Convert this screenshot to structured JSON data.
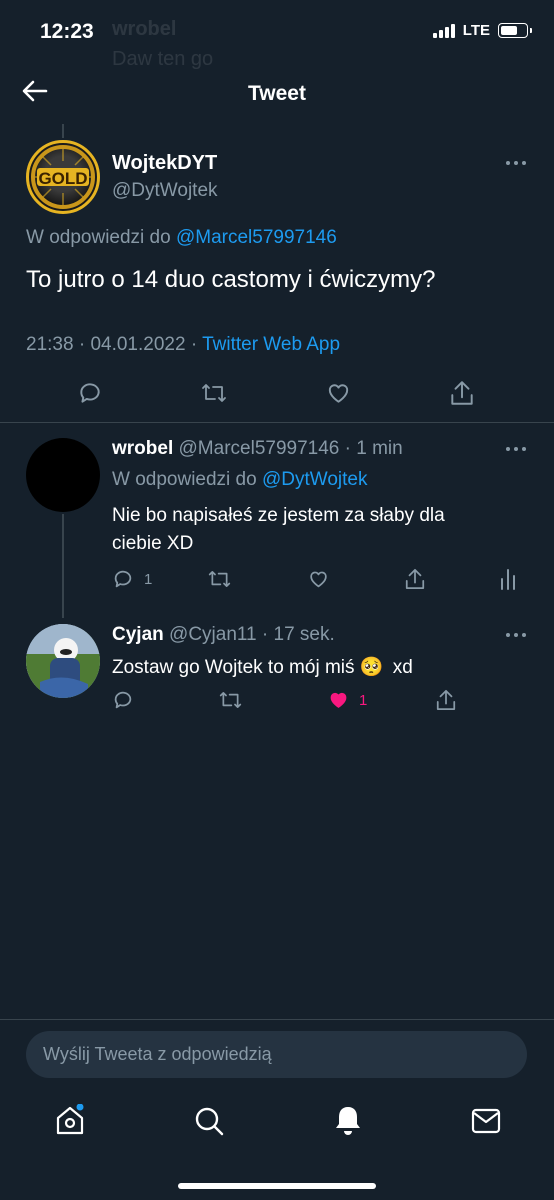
{
  "status_bar": {
    "time": "12:23",
    "network": "LTE"
  },
  "header": {
    "title": "Tweet"
  },
  "background_tweet": {
    "name": "wrobel",
    "text": "Daw ten go"
  },
  "main_tweet": {
    "display_name": "WojtekDYT",
    "handle": "@DytWojtek",
    "replying_prefix": "W odpowiedzi do",
    "replying_to": "@Marcel57997146",
    "text": "To jutro o 14 duo castomy i ćwiczymy?",
    "time": "21:38",
    "date": "04.01.2022",
    "source": "Twitter Web App",
    "avatar_text": "GOLD"
  },
  "replies": [
    {
      "display_name": "wrobel",
      "handle": "@Marcel57997146",
      "time_ago": "1 min",
      "replying_prefix": "W odpowiedzi do",
      "replying_to": "@DytWojtek",
      "text_line1": "Nie bo napisałeś ze jestem za słaby dla",
      "text_line2": "ciebie XD",
      "reply_count": "1"
    },
    {
      "display_name": "Cyjan",
      "handle": "@Cyjan11",
      "time_ago": "17 sek.",
      "text": "Zostaw go Wojtek to mój miś",
      "emoji": "🥺",
      "text_suffix": "xd",
      "like_count": "1"
    }
  ],
  "compose": {
    "placeholder": "Wyślij Tweeta z odpowiedzią"
  },
  "colors": {
    "background": "#15202b",
    "accent": "#1d9bf0",
    "like": "#f91880",
    "muted": "#8899a6"
  }
}
